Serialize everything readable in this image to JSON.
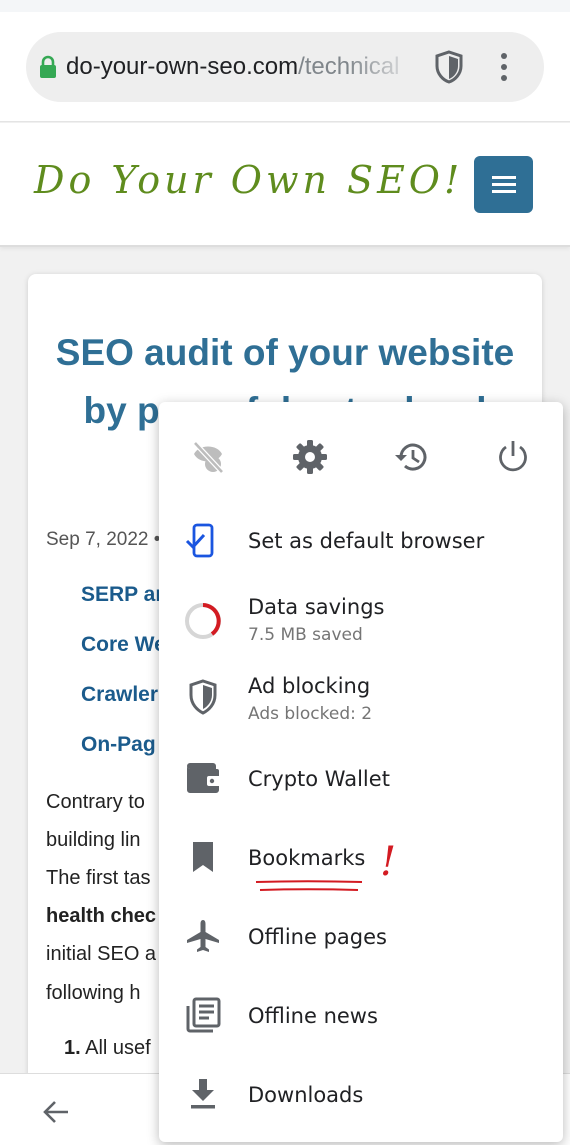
{
  "browser": {
    "url_host": "do-your-own-seo.com",
    "url_path": "/technical",
    "icons": {
      "lock": "lock-icon",
      "shield": "shield-icon",
      "menu": "more-vert-icon",
      "back": "arrow-back-icon"
    },
    "colors": {
      "lock": "#35a854",
      "urlbar_bg": "#eeeeee"
    }
  },
  "site": {
    "logo_text": "Do Your Own SEO!",
    "menu_icon": "hamburger-menu-icon",
    "colors": {
      "logo": "#5f8c1e",
      "accent": "#2f6f95"
    }
  },
  "article": {
    "title_line1": "SEO audit of your website",
    "title_line2": "by powerful entry-level",
    "meta": "Sep 7, 2022 •",
    "toc": [
      "SERP an",
      "Core We",
      "Crawler",
      "On-Pag"
    ],
    "body_lines": [
      "Contrary to",
      "building lin",
      "The first tas",
      "health chec",
      "initial SEO a",
      "following h"
    ],
    "list_item_number": "1.",
    "list_item_text": "All usef"
  },
  "menu": {
    "top_icons": [
      "incognito-off-icon",
      "settings-gear-icon",
      "history-icon",
      "power-icon"
    ],
    "items": [
      {
        "label": "Set as default browser",
        "icon": "phone-check-icon"
      },
      {
        "label": "Data savings",
        "sublabel": "7.5 MB saved",
        "icon": "data-savings-ring-icon"
      },
      {
        "label": "Ad blocking",
        "sublabel": "Ads blocked: 2",
        "icon": "shield-icon"
      },
      {
        "label": "Crypto Wallet",
        "icon": "wallet-icon"
      },
      {
        "label": "Bookmarks",
        "icon": "bookmark-icon"
      },
      {
        "label": "Offline pages",
        "icon": "airplane-icon"
      },
      {
        "label": "Offline news",
        "icon": "newspaper-icon"
      },
      {
        "label": "Downloads",
        "icon": "download-icon"
      }
    ],
    "annotation": {
      "mark": "!",
      "color": "#d31b22"
    }
  }
}
